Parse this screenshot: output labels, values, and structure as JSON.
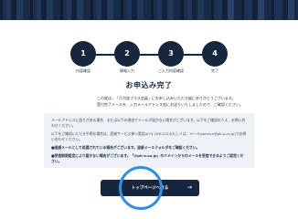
{
  "steps": [
    {
      "number": "1",
      "label": "内容確認"
    },
    {
      "number": "2",
      "label": "情報入力"
    },
    {
      "number": "3",
      "label": "ご入力内容確認"
    },
    {
      "number": "4",
      "label": "完了"
    }
  ],
  "title": "お申込み完了",
  "message": {
    "line1": "この度は、「月刊誌プラス会員」にお申し込みいただき誠にありがとうございます。",
    "line2": "受付完了メールを、入力メールアドレス宛にお送りいたしましたので、ご確認ください。"
  },
  "info": {
    "para1": "メールアドレスに誤りがある場合、または以下の理由でメールが届かない場合がございます。以下をご確認のうえ、お問い合わせください。",
    "para2": "以下をご確認いただき不明な場合は、読者サービス係へ電話(075-256-2224)もしくは、メール(service@ph-o.co.jp)でお問い合わせください。",
    "para3": "■迷惑メールとして処理されている場合がございます。迷惑メールフォルダをご確認ください。",
    "para4": "■受信制限設定により届かない場合がございます。「@ph-o.co.jp」のドメインからのメールを受信できるようご設定ください。"
  },
  "button": {
    "label": "トップページへ戻る",
    "arrow": "→"
  },
  "colors": {
    "navy": "#16263f",
    "panel": "#eef1f6",
    "ring": "#2f8fe6"
  }
}
